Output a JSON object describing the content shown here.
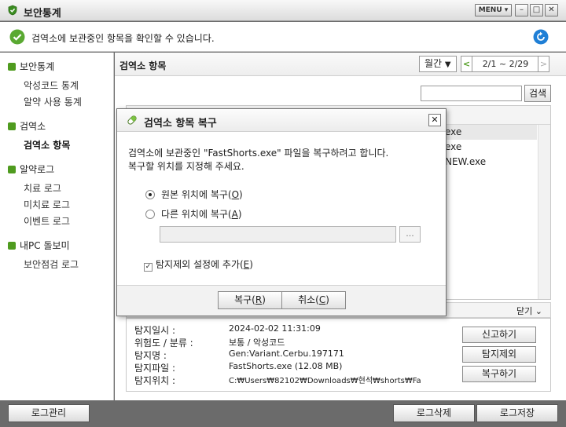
{
  "window": {
    "title": "보안통계",
    "menu_label": "MENU ▾",
    "min_label": "–",
    "max_label": "□",
    "close_label": "✕"
  },
  "status": {
    "message": "검역소에 보관중인 항목을 확인할 수 있습니다."
  },
  "sidebar": {
    "groups": [
      {
        "label": "보안통계",
        "items": [
          "악성코드 통계",
          "알약 사용 통계"
        ]
      },
      {
        "label": "검역소",
        "items": [
          "검역소 항목"
        ]
      },
      {
        "label": "알약로그",
        "items": [
          "치료 로그",
          "미치료 로그",
          "이벤트 로그"
        ]
      },
      {
        "label": "내PC 돌보미",
        "items": [
          "보안점검 로그"
        ]
      }
    ],
    "active_item": "검역소 항목"
  },
  "main": {
    "title": "검역소 항목",
    "period": "월간",
    "date_range": "2/1 ~ 2/29",
    "search_button": "검색",
    "list_rows": [
      "exe",
      "exe",
      "NEW.exe"
    ],
    "collapse_label": "닫기",
    "details": [
      {
        "label": "탐지일시 :",
        "value": "2024-02-02 11:31:09"
      },
      {
        "label": "위험도 / 분류 :",
        "value": "보통 / 악성코드"
      },
      {
        "label": "탐지명 :",
        "value": "Gen:Variant.Cerbu.197171"
      },
      {
        "label": "탐지파일 :",
        "value": "FastShorts.exe (12.08 MB)"
      },
      {
        "label": "탐지위치 :",
        "value": "C:₩Users₩82102₩Downloads₩현석₩shorts₩Fa"
      }
    ],
    "detail_buttons": [
      "신고하기",
      "탐지제외",
      "복구하기"
    ]
  },
  "bottom": {
    "log_manage": "로그관리",
    "log_delete": "로그삭제",
    "log_save": "로그저장"
  },
  "dialog": {
    "title": "검역소 항목 복구",
    "close_label": "✕",
    "message_line1": "검역소에 보관중인 \"FastShorts.exe\" 파일을 복구하려고 합니다.",
    "message_line2": "복구할 위치를 지정해 주세요.",
    "option_original": "원본 위치에 복구(",
    "option_original_key": "O",
    "option_other": "다른 위치에 복구(",
    "option_other_key": "A",
    "option_close": ")",
    "selected_option": "original",
    "browse_label": "...",
    "checkbox_label": "탐지제외 설정에 추가(",
    "checkbox_key": "E",
    "checkbox_checked": true,
    "restore_button": "복구(",
    "restore_key": "R",
    "cancel_button": "취소(",
    "cancel_key": "C"
  },
  "colors": {
    "accent_green": "#4f9b1f",
    "refresh_blue": "#1f7fd6"
  }
}
